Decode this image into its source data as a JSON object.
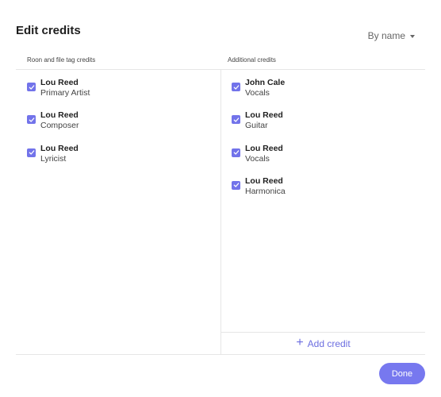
{
  "dialog": {
    "title": "Edit credits",
    "sort": {
      "selected": "By name",
      "icon": "caret-down-icon"
    }
  },
  "columns": {
    "left": {
      "header": "Roon and file tag credits",
      "items": [
        {
          "name": "Lou Reed",
          "role": "Primary Artist",
          "checked": true
        },
        {
          "name": "Lou Reed",
          "role": "Composer",
          "checked": true
        },
        {
          "name": "Lou Reed",
          "role": "Lyricist",
          "checked": true
        }
      ]
    },
    "right": {
      "header": "Additional credits",
      "items": [
        {
          "name": "John Cale",
          "role": "Vocals",
          "checked": true
        },
        {
          "name": "Lou Reed",
          "role": "Guitar",
          "checked": true
        },
        {
          "name": "Lou Reed",
          "role": "Vocals",
          "checked": true
        },
        {
          "name": "Lou Reed",
          "role": "Harmonica",
          "checked": true
        }
      ],
      "add_label": "Add credit",
      "add_icon": "plus-icon"
    }
  },
  "footer": {
    "done_label": "Done"
  },
  "colors": {
    "accent": "#7273ea",
    "button": "#7778ef",
    "link": "#6c6ee0"
  }
}
